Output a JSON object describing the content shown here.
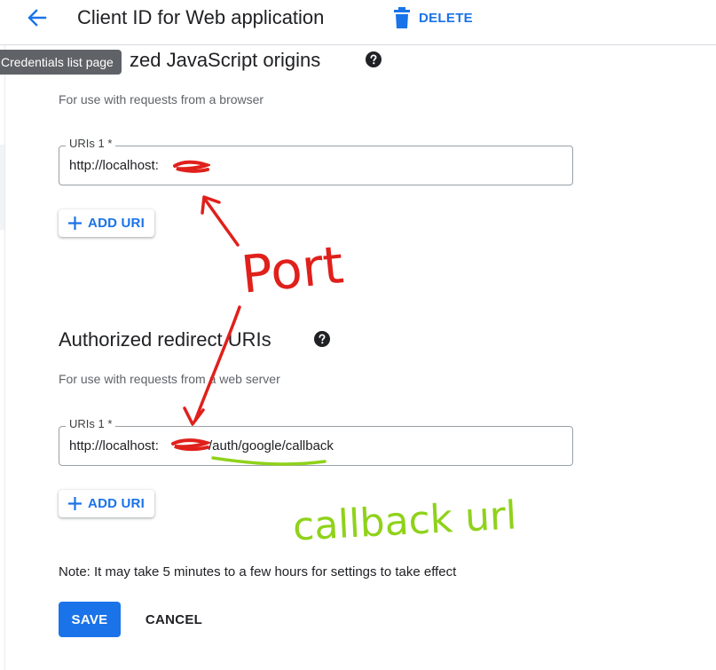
{
  "header": {
    "title": "Client ID for Web application",
    "delete_label": "DELETE"
  },
  "tooltip": {
    "text": "Credentials list page"
  },
  "js_origins": {
    "title_visible": "zed JavaScript origins",
    "description": "For use with requests from a browser",
    "field_label": "URIs 1 *",
    "field_value": "http://localhost:",
    "add_label": "ADD URI"
  },
  "redirect_uris": {
    "title": "Authorized redirect URIs",
    "description": "For use with requests from a web server",
    "field_label": "URIs 1 *",
    "field_value_prefix": "http://localhost:",
    "field_value_suffix": "/auth/google/callback",
    "add_label": "ADD URI"
  },
  "note": "Note: It may take 5 minutes to a few hours for settings to take effect",
  "actions": {
    "save_label": "SAVE",
    "cancel_label": "CANCEL"
  },
  "annotations": {
    "port_label": "Port",
    "callback_label": "callback url",
    "red_color": "#e0201b",
    "green_color": "#8fd21a"
  },
  "colors": {
    "primary": "#1a73e8",
    "text": "#202124",
    "secondary_text": "#5f6368",
    "border": "#9aa0a6",
    "tooltip_bg": "#5f6368"
  }
}
